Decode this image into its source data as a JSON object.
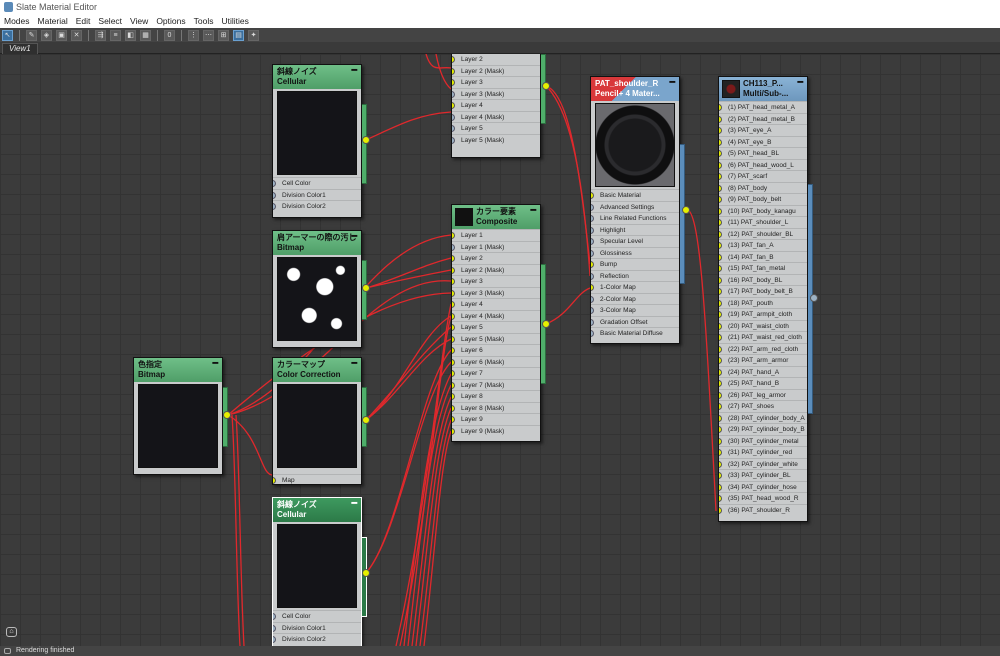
{
  "window": {
    "title": "Slate Material Editor"
  },
  "menu": [
    "Modes",
    "Material",
    "Edit",
    "Select",
    "View",
    "Options",
    "Tools",
    "Utilities"
  ],
  "toolbar": {
    "icons": [
      "select-arrow-icon",
      "eyedropper-icon",
      "put-to-scene-icon",
      "assign-icon",
      "delete-icon",
      "move-children-icon",
      "hide-unused-icon",
      "layout-icon",
      "background-icon",
      "show-map-icon",
      "number-zero-icon",
      "layout-all-icon",
      "layout-children-icon",
      "material-map-navigator-icon",
      "parameter-editor-icon",
      "select-by-material-icon"
    ]
  },
  "view_tab": "View1",
  "status": "Rendering finished",
  "nodes": {
    "composite_top": {
      "slots": [
        "Layer 2",
        "Layer 2 (Mask)",
        "Layer 3",
        "Layer 3 (Mask)",
        "Layer 4",
        "Layer 4 (Mask)",
        "Layer 5",
        "Layer 5 (Mask)"
      ]
    },
    "cellular1": {
      "title": "斜線ノイズ",
      "type": "Cellular",
      "slots": [
        "Cell Color",
        "Division Color1",
        "Division Color2"
      ]
    },
    "bitmap_shoulder": {
      "title": "肩アーマーの際の汚し",
      "type": "Bitmap"
    },
    "bitmap_color": {
      "title": "色指定",
      "type": "Bitmap"
    },
    "color_correction": {
      "title": "カラーマップ",
      "type": "Color Correction",
      "slots": [
        "Map"
      ]
    },
    "cellular2": {
      "title": "斜線ノイズ",
      "type": "Cellular",
      "slots": [
        "Cell Color",
        "Division Color1",
        "Division Color2"
      ]
    },
    "composite_main": {
      "title": "カラー要素",
      "type": "Composite",
      "slots": [
        "Layer 1",
        "Layer 1 (Mask)",
        "Layer 2",
        "Layer 2 (Mask)",
        "Layer 3",
        "Layer 3 (Mask)",
        "Layer 4",
        "Layer 4 (Mask)",
        "Layer 5",
        "Layer 5 (Mask)",
        "Layer 6",
        "Layer 6 (Mask)",
        "Layer 7",
        "Layer 7 (Mask)",
        "Layer 8",
        "Layer 8 (Mask)",
        "Layer 9",
        "Layer 9 (Mask)"
      ]
    },
    "pencil_material": {
      "title": "PAT_shoulder_R",
      "type": "Pencil+ 4 Mater...",
      "slots": [
        "Basic Material",
        "Advanced Settings",
        "Line Related Functions",
        "Highlight",
        "Specular Level",
        "Glossiness",
        "Bump",
        "Reflection",
        "1-Color Map",
        "2-Color Map",
        "3-Color Map",
        "Gradation Offset",
        "Basic Material Diffuse"
      ]
    },
    "multisub": {
      "title": "CH113_P...",
      "type": "Multi/Sub-...",
      "slots": [
        "(1) PAT_head_metal_A",
        "(2) PAT_head_metal_B",
        "(3) PAT_eye_A",
        "(4) PAT_eye_B",
        "(5) PAT_head_BL",
        "(6) PAT_head_wood_L",
        "(7) PAT_scarf",
        "(8) PAT_body",
        "(9) PAT_body_belt",
        "(10) PAT_body_kanagu",
        "(11) PAT_shoulder_L",
        "(12) PAT_shoulder_BL",
        "(13) PAT_fan_A",
        "(14) PAT_fan_B",
        "(15) PAT_fan_metal",
        "(16) PAT_body_BL",
        "(17) PAT_body_belt_B",
        "(18) PAT_pouth",
        "(19) PAT_armpit_cloth",
        "(20) PAT_waist_cloth",
        "(21) PAT_waist_red_cloth",
        "(22) PAT_arm_red_cloth",
        "(23) PAT_arm_armor",
        "(24) PAT_hand_A",
        "(25) PAT_hand_B",
        "(26) PAT_leg_armor",
        "(27) PAT_shoes",
        "(28) PAT_cylinder_body_A",
        "(29) PAT_cylinder_body_B",
        "(30) PAT_cylinder_metal",
        "(31) PAT_cylinder_red",
        "(32) PAT_cylinder_white",
        "(33) PAT_cylinder_BL",
        "(34) PAT_cylinder_hose",
        "(35) PAT_head_wood_R",
        "(36) PAT_shoulder_R"
      ]
    }
  },
  "colors": {
    "wire": "#e0282c",
    "socket_on": "#e6f000",
    "socket_off": "#9db2c4",
    "map_node": "#5fae78",
    "material_node": "#7aa5cc"
  }
}
